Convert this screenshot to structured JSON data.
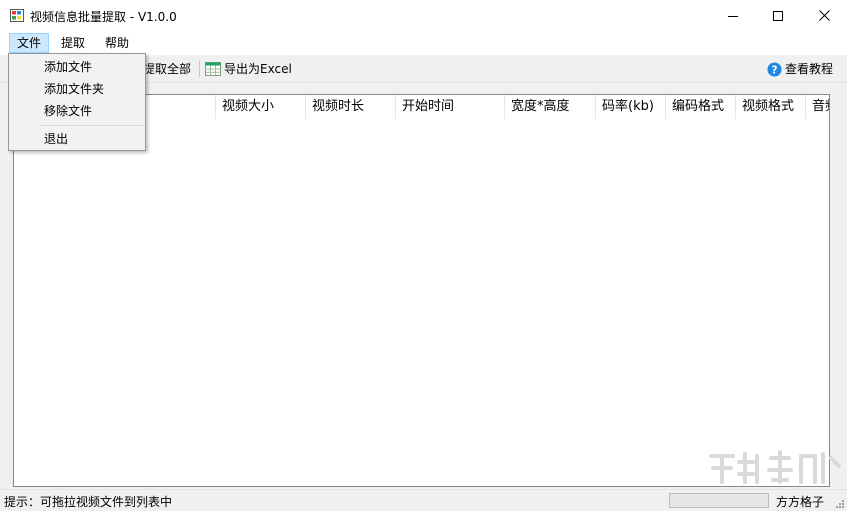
{
  "window": {
    "title": "视频信息批量提取 - V1.0.0"
  },
  "menubar": {
    "items": [
      {
        "label": "文件",
        "active": true
      },
      {
        "label": "提取",
        "active": false
      },
      {
        "label": "帮助",
        "active": false
      }
    ]
  },
  "file_menu": {
    "items": [
      "添加文件",
      "添加文件夹",
      "移除文件"
    ],
    "exit": "退出"
  },
  "toolbar": {
    "extract_all": "提取全部",
    "export_excel": "导出为Excel",
    "tutorial": "查看教程"
  },
  "table": {
    "columns": [
      "视频大小",
      "视频时长",
      "开始时间",
      "宽度*高度",
      "码率(kb)",
      "编码格式",
      "视频格式",
      "音频"
    ]
  },
  "statusbar": {
    "hint": "提示：可拖拉视频文件到列表中",
    "brand": "方方格子"
  },
  "icons": {
    "app": "app-window-icon",
    "excel": "excel-icon",
    "help": "help-circle-icon"
  },
  "colors": {
    "menu_highlight": "#cce8ff",
    "help_icon": "#1e88e5",
    "excel_green": "#21a366"
  }
}
